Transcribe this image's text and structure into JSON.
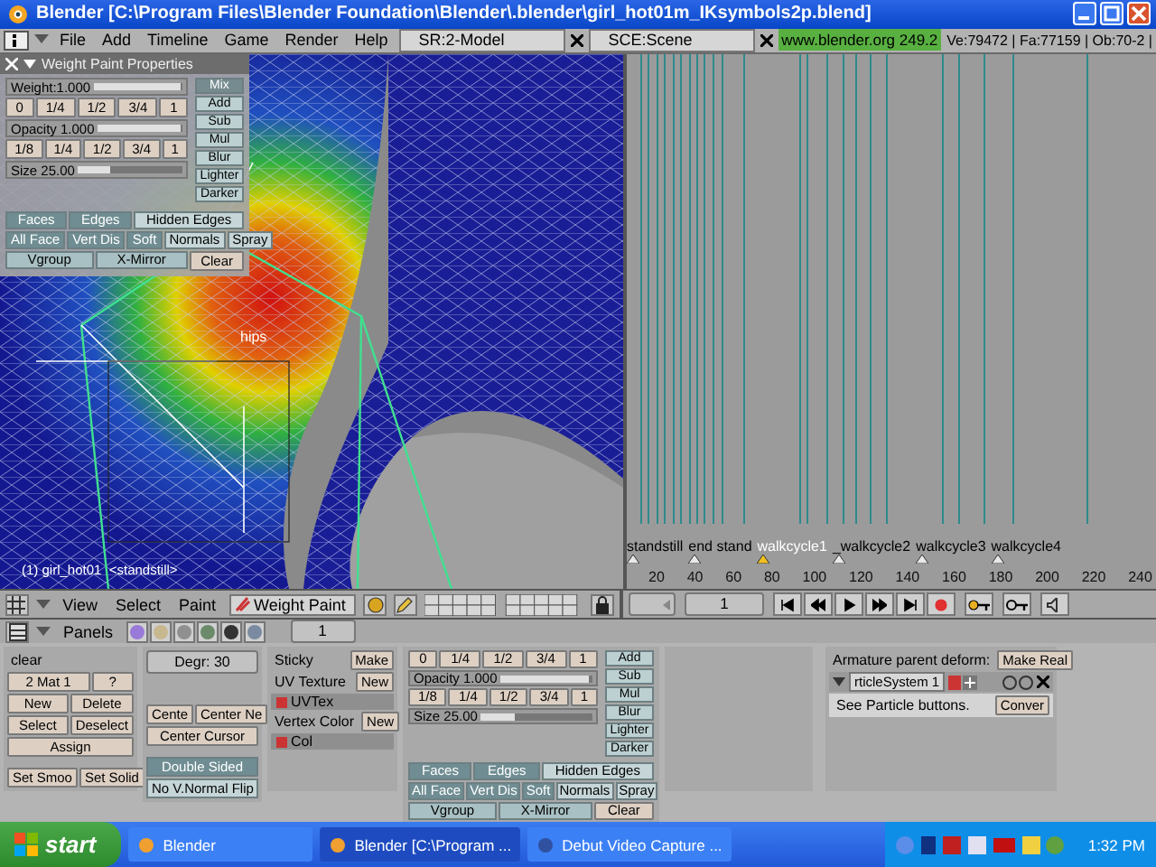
{
  "window": {
    "title": "Blender [C:\\Program Files\\Blender Foundation\\Blender\\.blender\\girl_hot01m_IKsymbols2p.blend]"
  },
  "menu_bar": {
    "menus": [
      "File",
      "Add",
      "Timeline",
      "Game",
      "Render",
      "Help"
    ],
    "screen": "SR:2-Model",
    "scene": "SCE:Scene",
    "version": "www.blender.org 249.2",
    "stats": "Ve:79472 | Fa:77159 | Ob:70-2 |"
  },
  "viewport": {
    "bone_label": "hips",
    "object_info": "(1) girl_hot01  <standstill>"
  },
  "weight_panel": {
    "title": "Weight Paint Properties",
    "weight": {
      "label": "Weight:1.000",
      "level": 0.97
    },
    "weight_presets": [
      "0",
      "1/4",
      "1/2",
      "3/4",
      "1"
    ],
    "opacity": {
      "label": "Opacity 1.000",
      "level": 0.97
    },
    "opacity_presets": [
      "1/8",
      "1/4",
      "1/2",
      "3/4",
      "1"
    ],
    "size": {
      "label": "Size 25.00",
      "level": 0.3
    },
    "modes": [
      {
        "label": "Mix",
        "selected": true
      },
      {
        "label": "Add",
        "selected": false
      },
      {
        "label": "Sub",
        "selected": false
      },
      {
        "label": "Mul",
        "selected": false
      },
      {
        "label": "Blur",
        "selected": false
      },
      {
        "label": "Lighter",
        "selected": false
      },
      {
        "label": "Darker",
        "selected": false
      }
    ],
    "view_toggles": [
      {
        "label": "Faces",
        "on": true
      },
      {
        "label": "Edges",
        "on": true
      },
      {
        "label": "Hidden Edges",
        "on": false
      }
    ],
    "options": [
      {
        "label": "All Face",
        "on": true
      },
      {
        "label": "Vert Dis",
        "on": true
      },
      {
        "label": "Soft",
        "on": true
      },
      {
        "label": "Normals",
        "on": false
      },
      {
        "label": "Spray",
        "on": false
      }
    ],
    "actions": [
      "Vgroup",
      "X-Mirror",
      "Clear"
    ]
  },
  "view3d_header": {
    "menus": [
      "View",
      "Select",
      "Paint"
    ],
    "mode": "Weight Paint"
  },
  "timeline": {
    "markers": [
      {
        "label": "standstill",
        "selected": false
      },
      {
        "label": "end stand",
        "selected": false
      },
      {
        "label": "walkcycle1",
        "selected": true
      },
      {
        "label": "_walkcycle2",
        "selected": false
      },
      {
        "label": "walkcycle3",
        "selected": false
      },
      {
        "label": "walkcycle4",
        "selected": false
      }
    ],
    "ruler": [
      "20",
      "40",
      "60",
      "80",
      "100",
      "120",
      "140",
      "160",
      "180",
      "200",
      "220",
      "240"
    ],
    "frame": "1"
  },
  "buttons": {
    "header": {
      "label": "Panels",
      "frame": "1"
    },
    "link_panel": {
      "label": "clear",
      "material": "2 Mat 1",
      "help": "?",
      "buttons": [
        "New",
        "Delete",
        "Select",
        "Deselect",
        "Assign"
      ],
      "shading": [
        "Set Smoo",
        "Set Solid"
      ]
    },
    "mesh_panel": {
      "degree": "Degr: 30",
      "center": [
        "Cente",
        "Center Ne"
      ],
      "center_cursor": "Center Cursor",
      "toggles": [
        {
          "label": "Double Sided",
          "on": true
        },
        {
          "label": "No V.Normal Flip",
          "on": false
        }
      ]
    },
    "texture_panel": {
      "sticky": "Sticky",
      "make": "Make",
      "uv_texture": "UV Texture",
      "uv_new": "New",
      "uv_layer": "UVTex",
      "vertex_color": "Vertex Color",
      "vc_new": "New",
      "vc_layer": "Col"
    },
    "weight_panel": {
      "weight_presets": [
        "0",
        "1/4",
        "1/2",
        "3/4",
        "1"
      ],
      "opacity": {
        "label": "Opacity 1.000",
        "level": 0.97
      },
      "opacity_presets": [
        "1/8",
        "1/4",
        "1/2",
        "3/4",
        "1"
      ],
      "size": {
        "label": "Size 25.00",
        "level": 0.3
      },
      "modes": [
        {
          "label": "Add",
          "selected": false
        },
        {
          "label": "Sub",
          "selected": false
        },
        {
          "label": "Mul",
          "selected": false
        },
        {
          "label": "Blur",
          "selected": false
        },
        {
          "label": "Lighter",
          "selected": false
        },
        {
          "label": "Darker",
          "selected": false
        }
      ],
      "view_toggles": [
        {
          "label": "Faces",
          "on": true
        },
        {
          "label": "Edges",
          "on": true
        },
        {
          "label": "Hidden Edges",
          "on": false
        }
      ],
      "options": [
        {
          "label": "All Face",
          "on": true
        },
        {
          "label": "Vert Dis",
          "on": true
        },
        {
          "label": "Soft",
          "on": true
        },
        {
          "label": "Normals",
          "on": false
        },
        {
          "label": "Spray",
          "on": false
        }
      ],
      "actions": [
        "Vgroup",
        "X-Mirror",
        "Clear"
      ]
    },
    "modifier_panel": {
      "armature": "Armature parent deform:",
      "make_real": "Make Real",
      "modifier": "rticleSystem 1",
      "note": "See Particle buttons.",
      "convert": "Conver"
    }
  },
  "taskbar": {
    "start": "start",
    "tasks": [
      {
        "label": "Blender",
        "selected": false
      },
      {
        "label": "Blender [C:\\Program ...",
        "selected": true
      },
      {
        "label": "Debut Video Capture ...",
        "selected": false
      }
    ],
    "clock": "1:32 PM"
  }
}
